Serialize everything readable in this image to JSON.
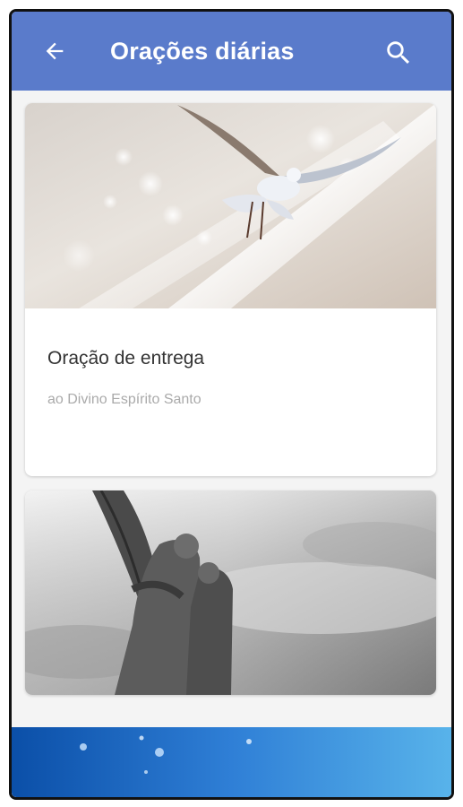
{
  "appbar": {
    "title": "Orações diárias",
    "back_icon": "arrow-left-icon",
    "search_icon": "search-icon",
    "color": "#5a7bcb"
  },
  "cards": [
    {
      "title": "Oração de entrega",
      "subtitle": "ao Divino Espírito Santo",
      "image": "dove-in-light-rays"
    },
    {
      "image": "angel-statue-grayscale"
    }
  ],
  "banner": {
    "image": "blue-water-bubbles"
  }
}
